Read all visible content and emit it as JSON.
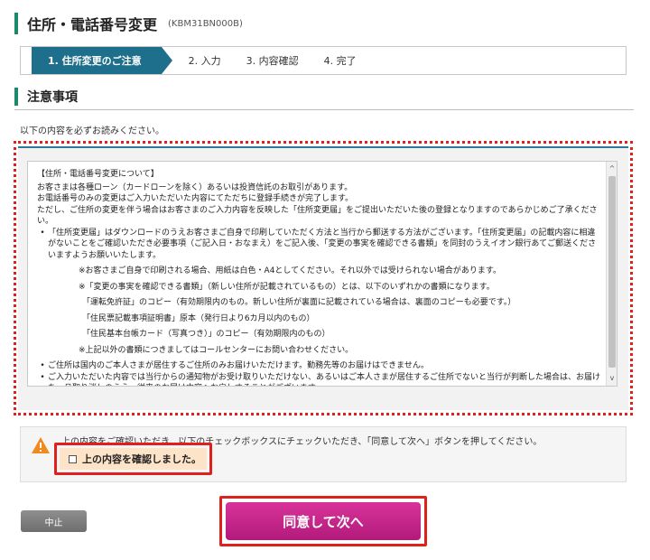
{
  "page": {
    "title": "住所・電話番号変更",
    "code": "(KBM31BN000B)"
  },
  "steps": [
    {
      "label": "1. 住所変更のご注意"
    },
    {
      "label": "2. 入力"
    },
    {
      "label": "3. 内容確認"
    },
    {
      "label": "4. 完了"
    }
  ],
  "section": {
    "title": "注意事項",
    "lead": "以下の内容を必ずお読みください。"
  },
  "notice": {
    "heading": "【住所・電話番号変更について】",
    "p1": "お客さまは各種ローン（カードローンを除く）あるいは投資信託のお取引があります。",
    "p2": "お電話番号のみの変更はご入力いただいた内容にてただちに登録手続きが完了します。",
    "p3": "ただし、ご住所の変更を伴う場合はお客さまのご入力内容を反映した「住所変更届」をご提出いただいた後の登録となりますのであらかじめご了承ください。",
    "b1": "「住所変更届」はダウンロードのうえお客さまご自身で印刷していただく方法と当行から郵送する方法がございます。「住所変更届」の記載内容に相違がないことをご確認いただき必要事項（ご記入日・おなまえ）をご記入後、「変更の事実を確認できる書類」を同封のうえイオン銀行あてご郵送くださいますようお願いいたします。",
    "s1": "※お客さまご自身で印刷される場合、用紙は白色・A4としてください。それ以外では受けられない場合があります。",
    "s2": "※「変更の事実を確認できる書類」（新しい住所が記載されているもの）とは、以下のいずれかの書類になります。",
    "d1": "「運転免許証」のコピー（有効期限内のもの。新しい住所が裏面に記載されている場合は、裏面のコピーも必要です。）",
    "d2": "「住民票記載事項証明書」原本（発行日より6カ月以内のもの）",
    "d3": "「住民基本台帳カード（写真つき）」のコピー（有効期限内のもの）",
    "s3": "※上記以外の書類につきましてはコールセンターにお問い合わせください。",
    "b2": "ご住所は国内のご本人さまが居住するご住所のみお届けいただけます。勤務先等のお届けはできません。",
    "b3": "ご入力いただいた内容では当行からの通知物がお受け取りいただけない、あるいはご本人さまが居住するご住所でないと当行が判断した場合は、お届けを一旦取り消しのうえ、従来のお届け内容へお戻しすることがございます。",
    "bullet_mark": "•",
    "scroll_up": "^",
    "scroll_down": "v"
  },
  "confirm": {
    "instruction": "上の内容をご確認いただき、以下のチェックボックスにチェックいただき、「同意して次へ」ボタンを押してください。",
    "checkbox_label": "上の内容を確認しました。"
  },
  "buttons": {
    "cancel": "中止",
    "agree": "同意して次へ"
  },
  "colors": {
    "accent_green": "#1a8a6b",
    "step_active": "#1e6f8c",
    "highlight_red": "#e0201c",
    "agree_button": "#c4258a",
    "warning_orange": "#f08a1c"
  }
}
